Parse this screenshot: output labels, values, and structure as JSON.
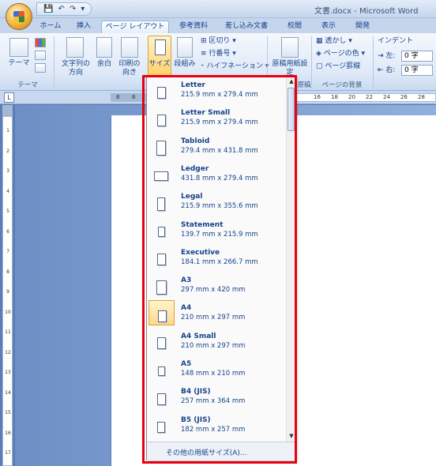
{
  "window": {
    "title": "文書.docx - Microsoft Word"
  },
  "quick_access": {
    "save": "💾",
    "undo": "↶",
    "redo": "↷"
  },
  "tabs": [
    {
      "label": "ホーム",
      "active": false
    },
    {
      "label": "挿入",
      "active": false
    },
    {
      "label": "ページ レイアウト",
      "active": true
    },
    {
      "label": "参考資料",
      "active": false
    },
    {
      "label": "差し込み文書",
      "active": false
    },
    {
      "label": "校閲",
      "active": false
    },
    {
      "label": "表示",
      "active": false
    },
    {
      "label": "開発",
      "active": false
    }
  ],
  "ribbon": {
    "theme_label": "テーマ",
    "theme_group": "テーマ",
    "text_direction": "文字列の方向",
    "margins": "余白",
    "orientation": "印刷の向き",
    "size": "サイズ",
    "columns": "段組み",
    "breaks": "区切り",
    "line_numbers": "行番号",
    "hyphenation": "ハイフネーション",
    "manuscript": "原稿用紙設定",
    "manuscript_group": "原稿用紙",
    "watermark": "透かし",
    "page_color": "ページの色",
    "page_borders": "ページ罫線",
    "page_bg_group": "ページの背景",
    "indent_title": "インデント",
    "indent_left_label": "左:",
    "indent_right_label": "右:",
    "indent_left_value": "0 字",
    "indent_right_value": "0 字"
  },
  "ruler": {
    "left_numbers": [
      "8",
      "6"
    ],
    "right_numbers": [
      "16",
      "18",
      "20",
      "22",
      "24",
      "26",
      "28"
    ],
    "vertical_numbers": [
      "1",
      "2",
      "3",
      "4",
      "5",
      "6",
      "7",
      "8",
      "9",
      "10",
      "11",
      "12",
      "13",
      "14",
      "15",
      "16",
      "17"
    ]
  },
  "paper_sizes": [
    {
      "name": "Letter",
      "dims": "215.9 mm x 279.4 mm",
      "selected": false
    },
    {
      "name": "Letter Small",
      "dims": "215.9 mm x 279.4 mm",
      "selected": false
    },
    {
      "name": "Tabloid",
      "dims": "279.4 mm x 431.8 mm",
      "selected": false
    },
    {
      "name": "Ledger",
      "dims": "431.8 mm x 279.4 mm",
      "selected": false
    },
    {
      "name": "Legal",
      "dims": "215.9 mm x 355.6 mm",
      "selected": false
    },
    {
      "name": "Statement",
      "dims": "139.7 mm x 215.9 mm",
      "selected": false
    },
    {
      "name": "Executive",
      "dims": "184.1 mm x 266.7 mm",
      "selected": false
    },
    {
      "name": "A3",
      "dims": "297 mm x 420 mm",
      "selected": false
    },
    {
      "name": "A4",
      "dims": "210 mm x 297 mm",
      "selected": true
    },
    {
      "name": "A4 Small",
      "dims": "210 mm x 297 mm",
      "selected": false
    },
    {
      "name": "A5",
      "dims": "148 mm x 210 mm",
      "selected": false
    },
    {
      "name": "B4 (JIS)",
      "dims": "257 mm x 364 mm",
      "selected": false
    },
    {
      "name": "B5 (JIS)",
      "dims": "182 mm x 257 mm",
      "selected": false
    }
  ],
  "dropdown": {
    "more_sizes": "その他の用紙サイズ(A)..."
  },
  "colors": {
    "highlight": "#e60012",
    "accent": "#15428b"
  }
}
